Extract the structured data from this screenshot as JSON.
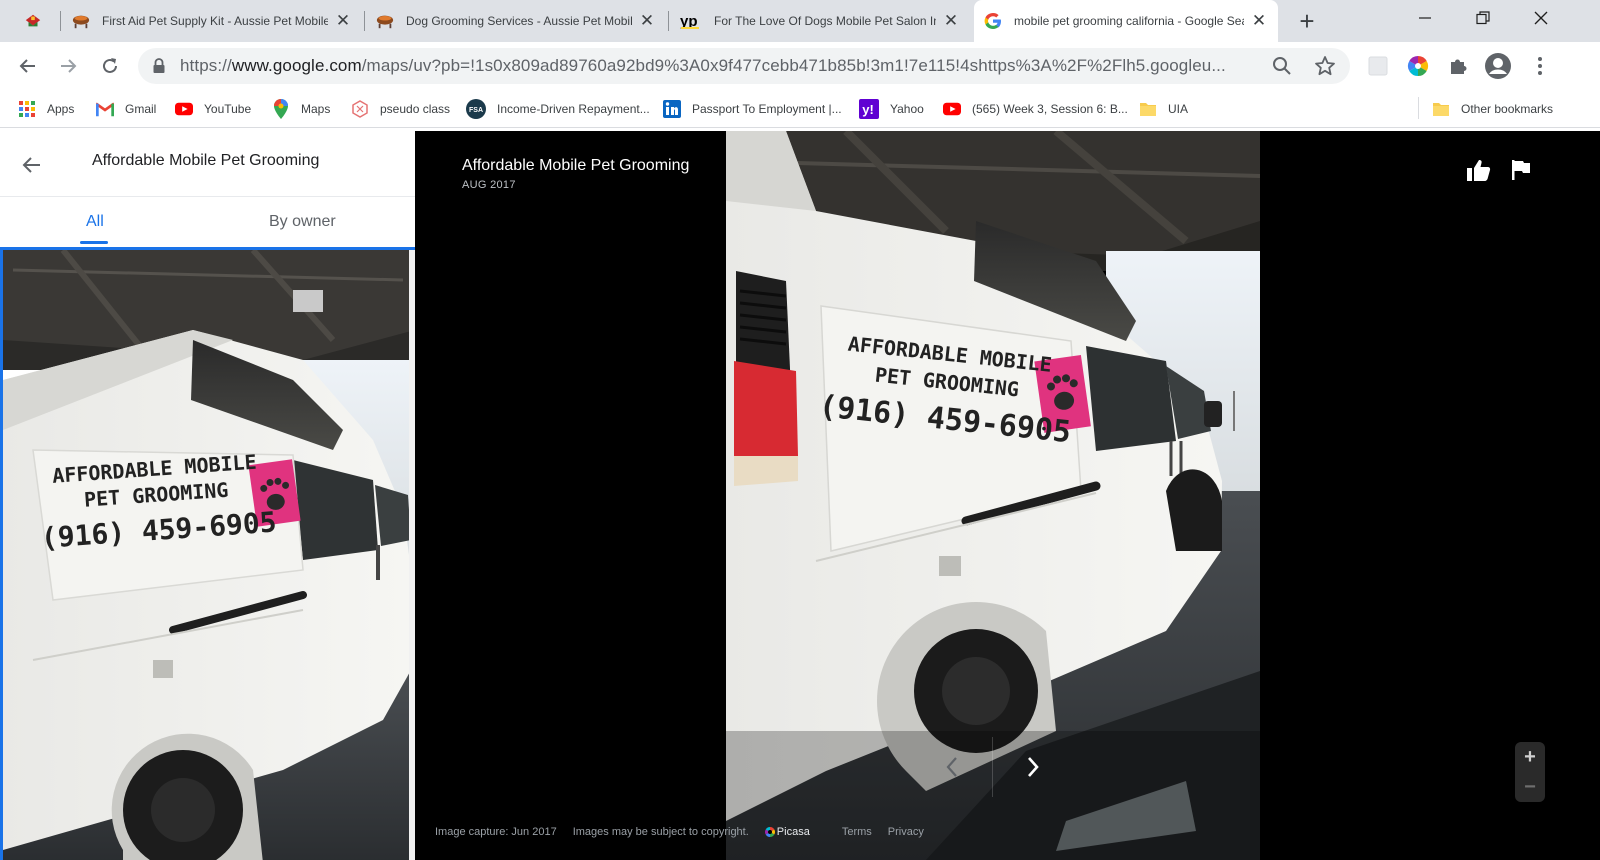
{
  "browser": {
    "tabs": [
      {
        "title": "First Aid Pet Supply Kit - Aussie Pet Mobile W",
        "icon": "bbq-grill-favicon",
        "active": false
      },
      {
        "title": "Dog Grooming Services - Aussie Pet Mobile",
        "icon": "bbq-grill-favicon",
        "active": false
      },
      {
        "title": "For The Love Of Dogs Mobile Pet Salon Inc i",
        "icon": "yp-favicon",
        "active": false
      },
      {
        "title": "mobile pet grooming california - Google Sea",
        "icon": "google-favicon",
        "active": true
      }
    ],
    "address": {
      "scheme": "https://",
      "host": "www.google.com",
      "path": "/maps/uv?pb=!1s0x809ad89760a92bd9%3A0x9f477cebb471b85b!3m1!7e115!4shttps%3A%2F%2Flh5.googleu..."
    },
    "bookmarks": [
      {
        "label": "Apps",
        "icon": "apps-grid-icon"
      },
      {
        "label": "Gmail",
        "icon": "gmail-icon"
      },
      {
        "label": "YouTube",
        "icon": "youtube-icon"
      },
      {
        "label": "Maps",
        "icon": "maps-pin-icon"
      },
      {
        "label": "pseudo class",
        "icon": "pseudo-class-icon"
      },
      {
        "label": "Income-Driven Repayment...",
        "icon": "fsa-icon"
      },
      {
        "label": "Passport To Employment |...",
        "icon": "linkedin-icon"
      },
      {
        "label": "Yahoo",
        "icon": "yahoo-icon"
      },
      {
        "label": "(565) Week 3, Session 6: B...",
        "icon": "youtube-icon"
      },
      {
        "label": "UIA",
        "icon": "folder-icon"
      }
    ],
    "other_bookmarks": "Other bookmarks"
  },
  "panel": {
    "title": "Affordable Mobile Pet Grooming",
    "tabs": [
      "All",
      "By owner"
    ],
    "active_tab": "All"
  },
  "viewer": {
    "title": "Affordable Mobile Pet Grooming",
    "date": "AUG 2017"
  },
  "van_decal": {
    "line1": "AFFORDABLE MOBILE",
    "line2": "PET GROOMING",
    "phone": "(916) 459-6905"
  },
  "footer": {
    "capture": "Image capture: Jun 2017",
    "copyright": "Images may be subject to copyright.",
    "brand": "Picasa",
    "terms": "Terms",
    "privacy": "Privacy"
  },
  "colors": {
    "accent": "#1a73e8",
    "decal_pink": "#e0337f",
    "tab_strip": "#dee1e6"
  }
}
